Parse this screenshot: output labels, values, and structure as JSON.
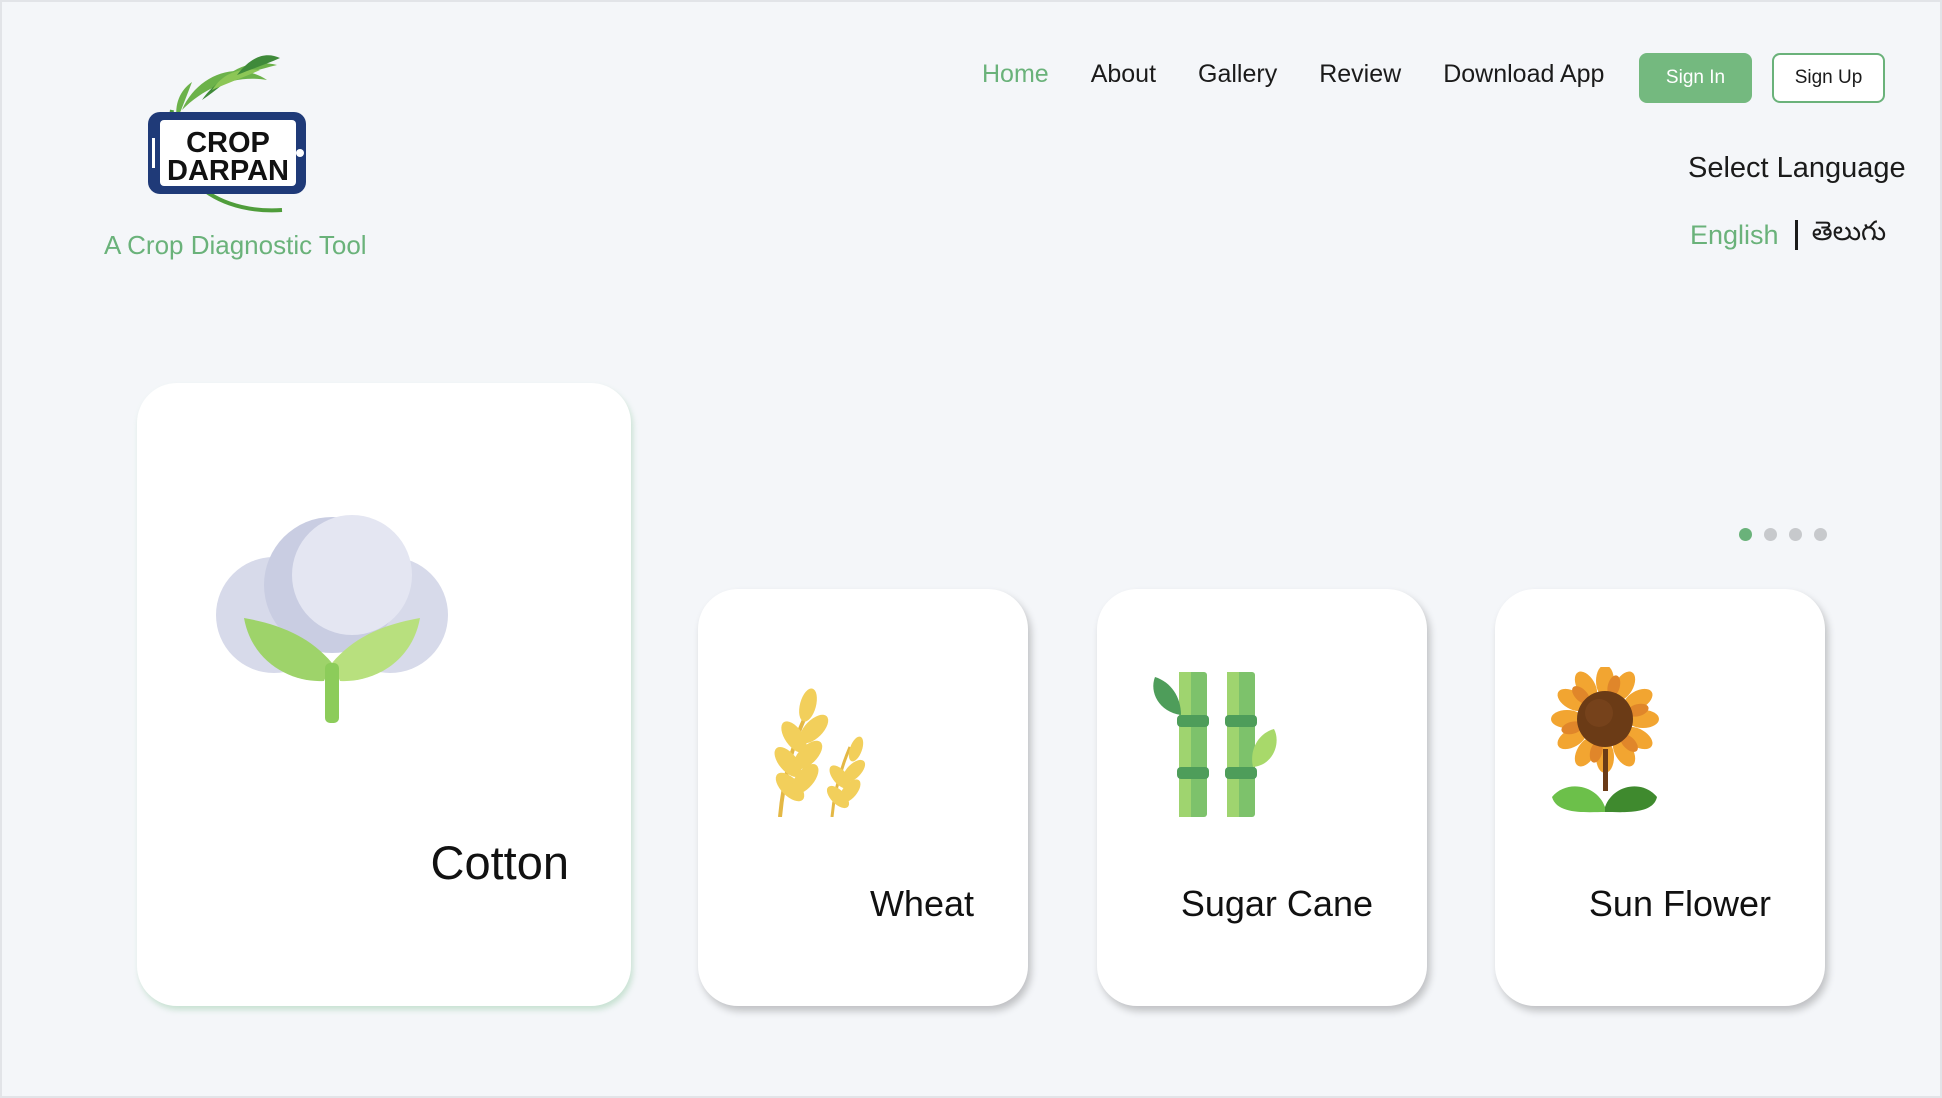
{
  "brand": {
    "logo_line1": "CROP",
    "logo_line2": "DARPAN",
    "tagline": "A Crop Diagnostic Tool"
  },
  "nav": {
    "items": [
      {
        "label": "Home",
        "active": true
      },
      {
        "label": "About",
        "active": false
      },
      {
        "label": "Gallery",
        "active": false
      },
      {
        "label": "Review",
        "active": false
      },
      {
        "label": "Download App",
        "active": false
      }
    ],
    "sign_in": "Sign In",
    "sign_up": "Sign Up"
  },
  "language": {
    "title": "Select Language",
    "options": [
      "English",
      "తెలుగు"
    ],
    "selected": "English"
  },
  "carousel": {
    "slide_count": 4,
    "active_index": 0,
    "cards": [
      {
        "label": "Cotton",
        "icon": "cotton-icon"
      },
      {
        "label": "Wheat",
        "icon": "wheat-icon"
      },
      {
        "label": "Sugar Cane",
        "icon": "sugarcane-icon"
      },
      {
        "label": "Sun Flower",
        "icon": "sunflower-icon"
      }
    ]
  },
  "colors": {
    "accent": "#6ab27a",
    "background": "#f4f6f9",
    "card": "#ffffff",
    "logo_frame": "#1f3a78"
  }
}
